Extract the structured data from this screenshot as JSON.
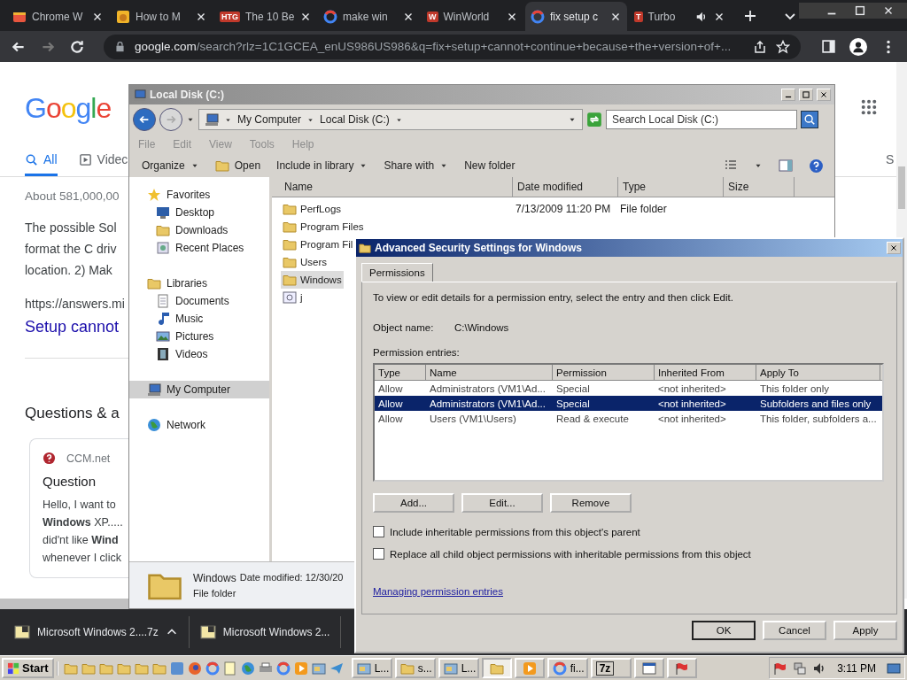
{
  "browser": {
    "tabs": [
      {
        "title": "Chrome W",
        "selected": false
      },
      {
        "title": "How to M",
        "selected": false
      },
      {
        "title": "The 10 Be",
        "icon_text": "HTG",
        "selected": false
      },
      {
        "title": "make win",
        "selected": false
      },
      {
        "title": "WinWorld",
        "icon_text": "W",
        "selected": false
      },
      {
        "title": "fix setup c",
        "selected": true
      },
      {
        "title": "Turbo",
        "icon_text": "T",
        "selected": false,
        "audio": true
      }
    ],
    "url_host": "google.com",
    "url_path": "/search?rlz=1C1GCEA_enUS986US986&q=fix+setup+cannot+continue+because+the+version+of+..."
  },
  "google": {
    "logo": "Google",
    "tabs": [
      {
        "label": "All",
        "selected": true
      },
      {
        "label": "Videc",
        "selected": false
      }
    ],
    "side_text": "S",
    "result_count": "About 581,000,00",
    "snippet": [
      "The possible Sol",
      "format the C driv",
      "location. 2) Mak"
    ],
    "url": "https://answers.mi",
    "title": "Setup cannot",
    "section": "Questions & a",
    "card": {
      "source": "CCM.net",
      "heading": "Question",
      "lines": [
        "Hello, I want to",
        "**Windows** XP.....",
        "did'nt like **Wind**",
        "whenever I click"
      ]
    }
  },
  "explorer": {
    "title": "Local Disk (C:)",
    "breadcrumb": [
      "My Computer",
      "Local Disk (C:)"
    ],
    "search_placeholder": "Search Local Disk (C:)",
    "menu": [
      "File",
      "Edit",
      "View",
      "Tools",
      "Help"
    ],
    "commands": [
      {
        "label": "Organize",
        "dropdown": true
      },
      {
        "label": "Open",
        "dropdown": false
      },
      {
        "label": "Include in library",
        "dropdown": true
      },
      {
        "label": "Share with",
        "dropdown": true
      },
      {
        "label": "New folder",
        "dropdown": false
      }
    ],
    "nav": [
      {
        "label": "Favorites",
        "selected": false,
        "children": [
          {
            "label": "Desktop",
            "selected": false
          },
          {
            "label": "Downloads",
            "selected": false
          },
          {
            "label": "Recent Places",
            "selected": false
          }
        ]
      },
      {
        "label": "Libraries",
        "selected": false,
        "children": [
          {
            "label": "Documents",
            "selected": false
          },
          {
            "label": "Music",
            "selected": false
          },
          {
            "label": "Pictures",
            "selected": false
          },
          {
            "label": "Videos",
            "selected": false
          }
        ]
      },
      {
        "label": "My Computer",
        "selected": true
      },
      {
        "label": "Network",
        "selected": false
      }
    ],
    "columns": [
      "Name",
      "Date modified",
      "Type",
      "Size"
    ],
    "files": [
      {
        "name": "PerfLogs",
        "date": "7/13/2009 11:20 PM",
        "type": "File folder",
        "kind": "folder",
        "selected": false
      },
      {
        "name": "Program Files",
        "kind": "folder",
        "selected": false
      },
      {
        "name": "Program Fil",
        "kind": "folder",
        "selected": false
      },
      {
        "name": "Users",
        "kind": "folder",
        "selected": false
      },
      {
        "name": "Windows",
        "kind": "folder",
        "selected": true
      },
      {
        "name": "j",
        "kind": "file",
        "selected": false
      }
    ],
    "details": {
      "name": "Windows",
      "meta": "Date modified: 12/30/20",
      "type": "File folder"
    }
  },
  "dialog": {
    "title": "Advanced Security Settings for Windows",
    "tabs": [
      {
        "label": "Permissions",
        "selected": true
      }
    ],
    "intro": "To view or edit details for a permission entry, select the entry and then click Edit.",
    "object_label": "Object name:",
    "object_value": "C:\\Windows",
    "entries_label": "Permission entries:",
    "columns": [
      "Type",
      "Name",
      "Permission",
      "Inherited From",
      "Apply To"
    ],
    "rows": [
      {
        "type": "Allow",
        "name": "Administrators (VM1\\Ad...",
        "permission": "Special",
        "inherited_from": "<not inherited>",
        "apply_to": "This folder only",
        "selected": false
      },
      {
        "type": "Allow",
        "name": "Administrators (VM1\\Ad...",
        "permission": "Special",
        "inherited_from": "<not inherited>",
        "apply_to": "Subfolders and files only",
        "selected": true
      },
      {
        "type": "Allow",
        "name": "Users (VM1\\Users)",
        "permission": "Read & execute",
        "inherited_from": "<not inherited>",
        "apply_to": "This folder, subfolders a...",
        "selected": false
      }
    ],
    "buttons": [
      "Add...",
      "Edit...",
      "Remove"
    ],
    "options": [
      {
        "label": "Include inheritable permissions from this object's parent",
        "checked": false
      },
      {
        "label": "Replace all child object permissions with inheritable permissions from this object",
        "checked": false
      }
    ],
    "link": "Managing permission entries",
    "footer_buttons": [
      {
        "label": "OK",
        "default": true
      },
      {
        "label": "Cancel",
        "default": false
      },
      {
        "label": "Apply",
        "default": false
      }
    ]
  },
  "downloads": [
    {
      "name": "Microsoft Windows 2....7z",
      "menu": true
    },
    {
      "name": "Microsoft Windows 2...",
      "menu": false
    }
  ],
  "taskbar": {
    "start": "Start",
    "tasks": [
      {
        "label": "L...",
        "selected": false
      },
      {
        "label": "s...",
        "selected": false
      },
      {
        "label": "L...",
        "selected": false
      },
      {
        "selected": true
      },
      {
        "selected": false
      },
      {
        "label": "fi...",
        "selected": false
      },
      {
        "label": "7z",
        "selected": false
      },
      {
        "selected": false
      },
      {
        "selected": false
      }
    ],
    "clock": "3:11 PM"
  }
}
